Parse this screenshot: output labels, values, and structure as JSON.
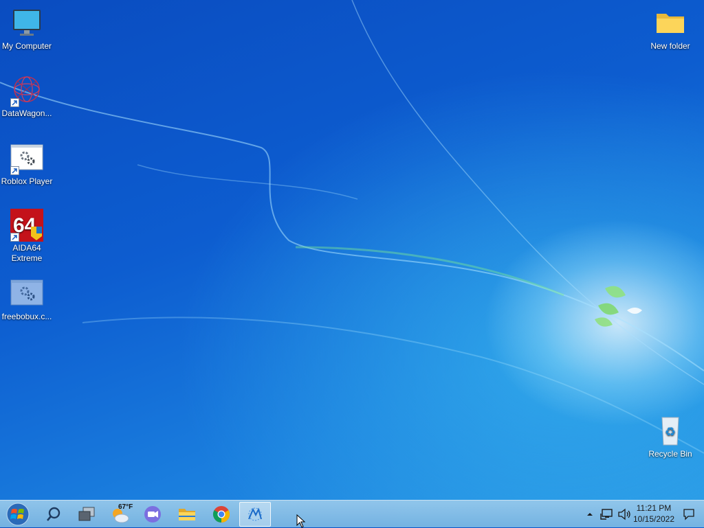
{
  "desktop": {
    "icons": [
      {
        "label": "My Computer",
        "icon": "monitor-icon"
      },
      {
        "label": "DataWagon...",
        "icon": "datawagon-icon"
      },
      {
        "label": "Roblox Player",
        "icon": "settings-app-icon"
      },
      {
        "label": "AIDA64 Extreme",
        "icon": "aida64-icon"
      },
      {
        "label": "freebobux.c...",
        "icon": "settings-app-icon"
      },
      {
        "label": "New folder",
        "icon": "folder-icon"
      },
      {
        "label": "Recycle Bin",
        "icon": "recycle-bin-icon"
      }
    ]
  },
  "taskbar": {
    "start_icon": "windows-start-icon",
    "search_icon": "search-icon",
    "task_view_icon": "task-view-icon",
    "weather": {
      "temp": "67°F",
      "icon": "weather-partly-cloudy-icon"
    },
    "apps": [
      {
        "name": "video-call-icon"
      },
      {
        "name": "file-explorer-icon"
      },
      {
        "name": "chrome-icon"
      },
      {
        "name": "datawagon-app-icon",
        "active": true
      }
    ],
    "tray": {
      "chevron_icon": "chevron-up-icon",
      "network_icon": "network-icon",
      "volume_icon": "volume-icon",
      "time": "11:21 PM",
      "date": "10/15/2022",
      "notification_icon": "notification-icon"
    }
  },
  "colors": {
    "wallpaper_dark": "#0a4cc0",
    "wallpaper_light": "#2a9ae6",
    "taskbar": "#8cc3e8"
  }
}
